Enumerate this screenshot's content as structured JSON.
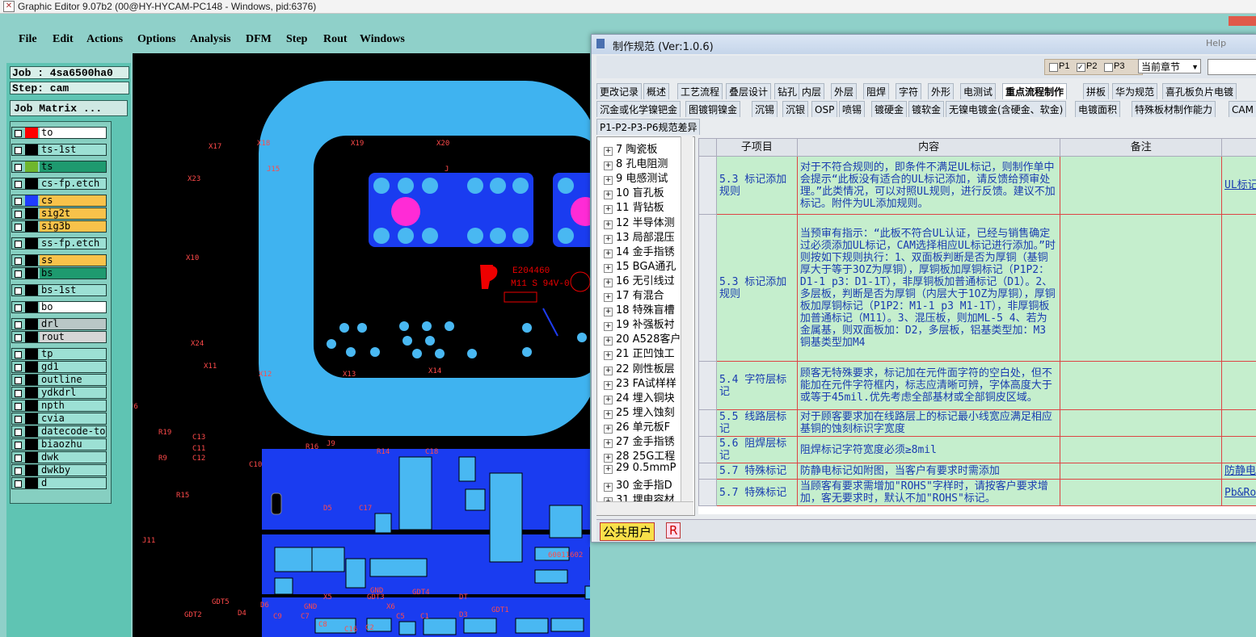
{
  "app": {
    "title": "Graphic Editor 9.07b2 (00@HY-HYCAM-PC148 - Windows, pid:6376)"
  },
  "menu": [
    "File",
    "Edit",
    "Actions",
    "Options",
    "Analysis",
    "DFM",
    "Step",
    "Rout",
    "Windows"
  ],
  "job": {
    "job_line": "Job : 4sa6500ha0",
    "step_line": "Step: cam",
    "matrix_button": "Job Matrix ..."
  },
  "layers": [
    {
      "name": "to",
      "color": "#ff0000",
      "bg": "#ffffff"
    },
    {
      "name": "ts-1st",
      "color": "#000000",
      "bg": "#9ce0d4"
    },
    {
      "name": "ts",
      "color": "#6fb62e",
      "bg": "#1e9a6f"
    },
    {
      "name": "cs-fp.etch",
      "color": "#000000",
      "bg": "#9ce0d4"
    },
    {
      "name": "cs",
      "color": "#1f3cff",
      "bg": "#f8c24a"
    },
    {
      "name": "sig2t",
      "color": "#000000",
      "bg": "#f8c24a"
    },
    {
      "name": "sig3b",
      "color": "#000000",
      "bg": "#f8c24a"
    },
    {
      "name": "ss-fp.etch",
      "color": "#000000",
      "bg": "#9ce0d4"
    },
    {
      "name": "ss",
      "color": "#000000",
      "bg": "#f8c24a"
    },
    {
      "name": "bs",
      "color": "#000000",
      "bg": "#1e9a6f"
    },
    {
      "name": "bs-1st",
      "color": "#000000",
      "bg": "#9ce0d4"
    },
    {
      "name": "bo",
      "color": "#000000",
      "bg": "#ffffff"
    },
    {
      "name": "drl",
      "color": "#000000",
      "bg": "#b9c7c6"
    },
    {
      "name": "rout",
      "color": "#000000",
      "bg": "#d6d6d6"
    },
    {
      "name": "tp",
      "color": "#000000",
      "bg": "#9ce0d4"
    },
    {
      "name": "gd1",
      "color": "#000000",
      "bg": "#9ce0d4"
    },
    {
      "name": "outline",
      "color": "#000000",
      "bg": "#9ce0d4"
    },
    {
      "name": "ydkdrl",
      "color": "#000000",
      "bg": "#9ce0d4"
    },
    {
      "name": "npth",
      "color": "#000000",
      "bg": "#9ce0d4"
    },
    {
      "name": "cvia",
      "color": "#000000",
      "bg": "#9ce0d4"
    },
    {
      "name": "datecode-to",
      "color": "#000000",
      "bg": "#9ce0d4"
    },
    {
      "name": "biaozhu",
      "color": "#000000",
      "bg": "#9ce0d4"
    },
    {
      "name": "dwk",
      "color": "#000000",
      "bg": "#9ce0d4"
    },
    {
      "name": "dwkby",
      "color": "#000000",
      "bg": "#9ce0d4"
    },
    {
      "name": "d",
      "color": "#000000",
      "bg": "#9ce0d4"
    }
  ],
  "pcb": {
    "labels": [
      "X17",
      "X18",
      "X19",
      "X20",
      "X23",
      "J15",
      "J",
      "X10",
      "X24",
      "X11",
      "X12",
      "X13",
      "X14",
      "J6",
      "R19",
      "C13",
      "C11",
      "R9",
      "C12",
      "C10",
      "R16",
      "J9",
      "R14",
      "C18",
      "R15",
      "D5",
      "C17",
      "J11",
      "GDT5",
      "D6",
      "GND",
      "X5",
      "GDT3",
      "GND",
      "X6",
      "GDT4",
      "DT",
      "GDT2",
      "D4",
      "C9",
      "C7",
      "C8",
      "C16",
      "C2",
      "C5",
      "C1",
      "D3",
      "GDT1",
      "60011602",
      "XF1"
    ],
    "marking": {
      "line1": "E204460",
      "line2": "M11 S 94V-0"
    }
  },
  "dialog": {
    "title": "制作规范 (Ver:1.0.6)",
    "help": "Help",
    "filters": {
      "p1": "P1",
      "p2": "P2",
      "p3": "P3",
      "p2_checked": true,
      "select": "当前章节"
    },
    "tabs_row1": [
      "更改记录",
      "概述",
      "工艺流程",
      "叠层设计",
      "钻孔",
      "内层",
      "外层",
      "阻焊",
      "字符",
      "外形",
      "电测试",
      "重点流程制作",
      "拼板",
      "华为规范",
      "喜孔板负片电镀"
    ],
    "tabs_row2": [
      "沉金或化学镍钯金",
      "图镀铜镍金",
      "沉锡",
      "沉银",
      "OSP",
      "喷锡",
      "镀硬金",
      "镀软金",
      "无镍电镀金(含硬金、软金)",
      "电镀面积",
      "特殊板材制作能力",
      "CAM"
    ],
    "tabs_row3": [
      "P1-P2-P3-P6规范差异"
    ],
    "active_tab": "重点流程制作",
    "tree": [
      "7 陶瓷板",
      "8 孔电阻测",
      "9 电感测试",
      "10 盲孔板",
      "11 背钻板",
      "12 半导体测",
      "13 局部混压",
      "14 金手指锈",
      "15 BGA通孔",
      "16 无引线过",
      "17 有混合",
      "18 特殊盲槽",
      "19 补强板衬",
      "20 A528客户",
      "21 正凹蚀工",
      "22 刚性板层",
      "23 FA试样样",
      "24 埋入铜块",
      "25 埋入蚀刻",
      "26 单元板F",
      "27 金手指锈",
      "28 25G工程",
      "29 0.5mmP",
      "30 金手指D",
      "31 埋电容材"
    ],
    "table": {
      "headers": [
        "子项目",
        "内容",
        "备注",
        ""
      ],
      "rows": [
        {
          "item": "5.3 标记添加规则",
          "content": "对于不符合规则的，即条件不满足UL标记，则制作单中会提示“此板没有适合的UL标记添加，请反馈给预审处理。”此类情况，可以对照UL规则，进行反馈。建议不加标记。附件为UL添加规则。",
          "note": "",
          "link": "UL标记"
        },
        {
          "item": "5.3 标记添加规则",
          "content": "当预审有指示：“此板不符合UL认证，已经与销售确定过必须添加UL标记，CAM选择相应UL标记进行添加。”时则按如下规则执行：1、双面板判断是否为厚铜（基铜厚大于等于3OZ为厚铜），厚铜板加厚铜标记（P1P2： D1-1 p3：D1-1T），非厚铜板加普通标记（D1）。2、多层板，判断是否为厚铜（内层大于1OZ为厚铜），厚铜板加厚铜标记（P1P2：M1-1 p3 M1-1T），非厚铜板加普通标记（M11）。3、混压板，则加ML-5 4、若为金属基，则双面板加：D2，多层板，铝基类型加：M3 铜基类型加M4",
          "note": "",
          "link": ""
        },
        {
          "item": "5.4 字符层标记",
          "content": "顾客无特殊要求，标记加在元件面字符的空白处，但不能加在元件字符框内，标志应清晰可辨，字体高度大于或等于45mil.优先考虑全部基材或全部铜皮区域。",
          "note": "",
          "link": ""
        },
        {
          "item": "5.5 线路层标记",
          "content": "对于顾客要求加在线路层上的标记最小线宽应满足相应基铜的蚀刻标识字宽度",
          "note": "",
          "link": ""
        },
        {
          "item": "5.6 阻焊层标记",
          "content": "阻焊标记字符宽度必须≥8mil",
          "note": "",
          "link": ""
        },
        {
          "item": "5.7 特殊标记",
          "content": "防静电标记如附图，当客户有要求时需添加",
          "note": "",
          "link": "防静电"
        },
        {
          "item": "5.7 特殊标记",
          "content": "当顾客有要求需增加\"ROHS\"字样时，请按客户要求增加，客无要求时，默认不加\"ROHS\"标记。",
          "note": "",
          "link": "Pb&Ro"
        }
      ]
    },
    "status": {
      "user": "公共用户",
      "role": "R"
    }
  },
  "colors": {
    "pcb_mask": "#3fb3f0",
    "pcb_copper": "#1a3cf0",
    "pcb_pad": "#49b8f2",
    "pink": "#ff2bd6",
    "table_bg": "#c5eecd",
    "table_border": "#d44"
  }
}
